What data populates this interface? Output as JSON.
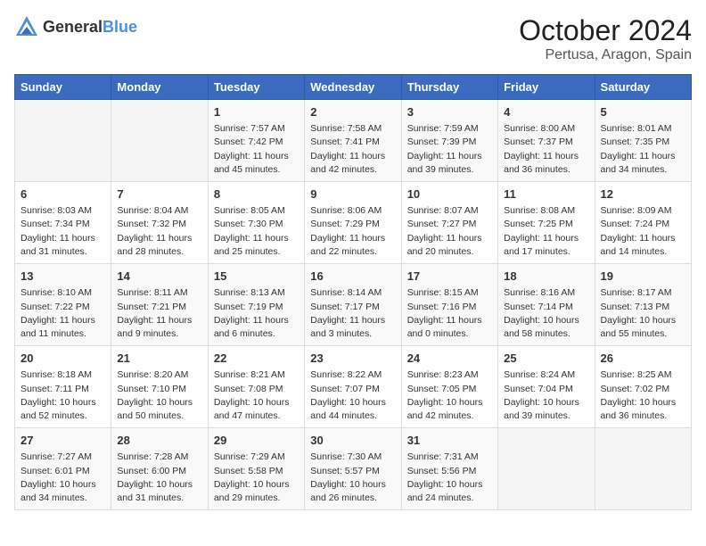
{
  "logo": {
    "text_general": "General",
    "text_blue": "Blue"
  },
  "title": "October 2024",
  "subtitle": "Pertusa, Aragon, Spain",
  "weekdays": [
    "Sunday",
    "Monday",
    "Tuesday",
    "Wednesday",
    "Thursday",
    "Friday",
    "Saturday"
  ],
  "weeks": [
    [
      {
        "day": "",
        "info": ""
      },
      {
        "day": "",
        "info": ""
      },
      {
        "day": "1",
        "info": "Sunrise: 7:57 AM\nSunset: 7:42 PM\nDaylight: 11 hours and 45 minutes."
      },
      {
        "day": "2",
        "info": "Sunrise: 7:58 AM\nSunset: 7:41 PM\nDaylight: 11 hours and 42 minutes."
      },
      {
        "day": "3",
        "info": "Sunrise: 7:59 AM\nSunset: 7:39 PM\nDaylight: 11 hours and 39 minutes."
      },
      {
        "day": "4",
        "info": "Sunrise: 8:00 AM\nSunset: 7:37 PM\nDaylight: 11 hours and 36 minutes."
      },
      {
        "day": "5",
        "info": "Sunrise: 8:01 AM\nSunset: 7:35 PM\nDaylight: 11 hours and 34 minutes."
      }
    ],
    [
      {
        "day": "6",
        "info": "Sunrise: 8:03 AM\nSunset: 7:34 PM\nDaylight: 11 hours and 31 minutes."
      },
      {
        "day": "7",
        "info": "Sunrise: 8:04 AM\nSunset: 7:32 PM\nDaylight: 11 hours and 28 minutes."
      },
      {
        "day": "8",
        "info": "Sunrise: 8:05 AM\nSunset: 7:30 PM\nDaylight: 11 hours and 25 minutes."
      },
      {
        "day": "9",
        "info": "Sunrise: 8:06 AM\nSunset: 7:29 PM\nDaylight: 11 hours and 22 minutes."
      },
      {
        "day": "10",
        "info": "Sunrise: 8:07 AM\nSunset: 7:27 PM\nDaylight: 11 hours and 20 minutes."
      },
      {
        "day": "11",
        "info": "Sunrise: 8:08 AM\nSunset: 7:25 PM\nDaylight: 11 hours and 17 minutes."
      },
      {
        "day": "12",
        "info": "Sunrise: 8:09 AM\nSunset: 7:24 PM\nDaylight: 11 hours and 14 minutes."
      }
    ],
    [
      {
        "day": "13",
        "info": "Sunrise: 8:10 AM\nSunset: 7:22 PM\nDaylight: 11 hours and 11 minutes."
      },
      {
        "day": "14",
        "info": "Sunrise: 8:11 AM\nSunset: 7:21 PM\nDaylight: 11 hours and 9 minutes."
      },
      {
        "day": "15",
        "info": "Sunrise: 8:13 AM\nSunset: 7:19 PM\nDaylight: 11 hours and 6 minutes."
      },
      {
        "day": "16",
        "info": "Sunrise: 8:14 AM\nSunset: 7:17 PM\nDaylight: 11 hours and 3 minutes."
      },
      {
        "day": "17",
        "info": "Sunrise: 8:15 AM\nSunset: 7:16 PM\nDaylight: 11 hours and 0 minutes."
      },
      {
        "day": "18",
        "info": "Sunrise: 8:16 AM\nSunset: 7:14 PM\nDaylight: 10 hours and 58 minutes."
      },
      {
        "day": "19",
        "info": "Sunrise: 8:17 AM\nSunset: 7:13 PM\nDaylight: 10 hours and 55 minutes."
      }
    ],
    [
      {
        "day": "20",
        "info": "Sunrise: 8:18 AM\nSunset: 7:11 PM\nDaylight: 10 hours and 52 minutes."
      },
      {
        "day": "21",
        "info": "Sunrise: 8:20 AM\nSunset: 7:10 PM\nDaylight: 10 hours and 50 minutes."
      },
      {
        "day": "22",
        "info": "Sunrise: 8:21 AM\nSunset: 7:08 PM\nDaylight: 10 hours and 47 minutes."
      },
      {
        "day": "23",
        "info": "Sunrise: 8:22 AM\nSunset: 7:07 PM\nDaylight: 10 hours and 44 minutes."
      },
      {
        "day": "24",
        "info": "Sunrise: 8:23 AM\nSunset: 7:05 PM\nDaylight: 10 hours and 42 minutes."
      },
      {
        "day": "25",
        "info": "Sunrise: 8:24 AM\nSunset: 7:04 PM\nDaylight: 10 hours and 39 minutes."
      },
      {
        "day": "26",
        "info": "Sunrise: 8:25 AM\nSunset: 7:02 PM\nDaylight: 10 hours and 36 minutes."
      }
    ],
    [
      {
        "day": "27",
        "info": "Sunrise: 7:27 AM\nSunset: 6:01 PM\nDaylight: 10 hours and 34 minutes."
      },
      {
        "day": "28",
        "info": "Sunrise: 7:28 AM\nSunset: 6:00 PM\nDaylight: 10 hours and 31 minutes."
      },
      {
        "day": "29",
        "info": "Sunrise: 7:29 AM\nSunset: 5:58 PM\nDaylight: 10 hours and 29 minutes."
      },
      {
        "day": "30",
        "info": "Sunrise: 7:30 AM\nSunset: 5:57 PM\nDaylight: 10 hours and 26 minutes."
      },
      {
        "day": "31",
        "info": "Sunrise: 7:31 AM\nSunset: 5:56 PM\nDaylight: 10 hours and 24 minutes."
      },
      {
        "day": "",
        "info": ""
      },
      {
        "day": "",
        "info": ""
      }
    ]
  ]
}
